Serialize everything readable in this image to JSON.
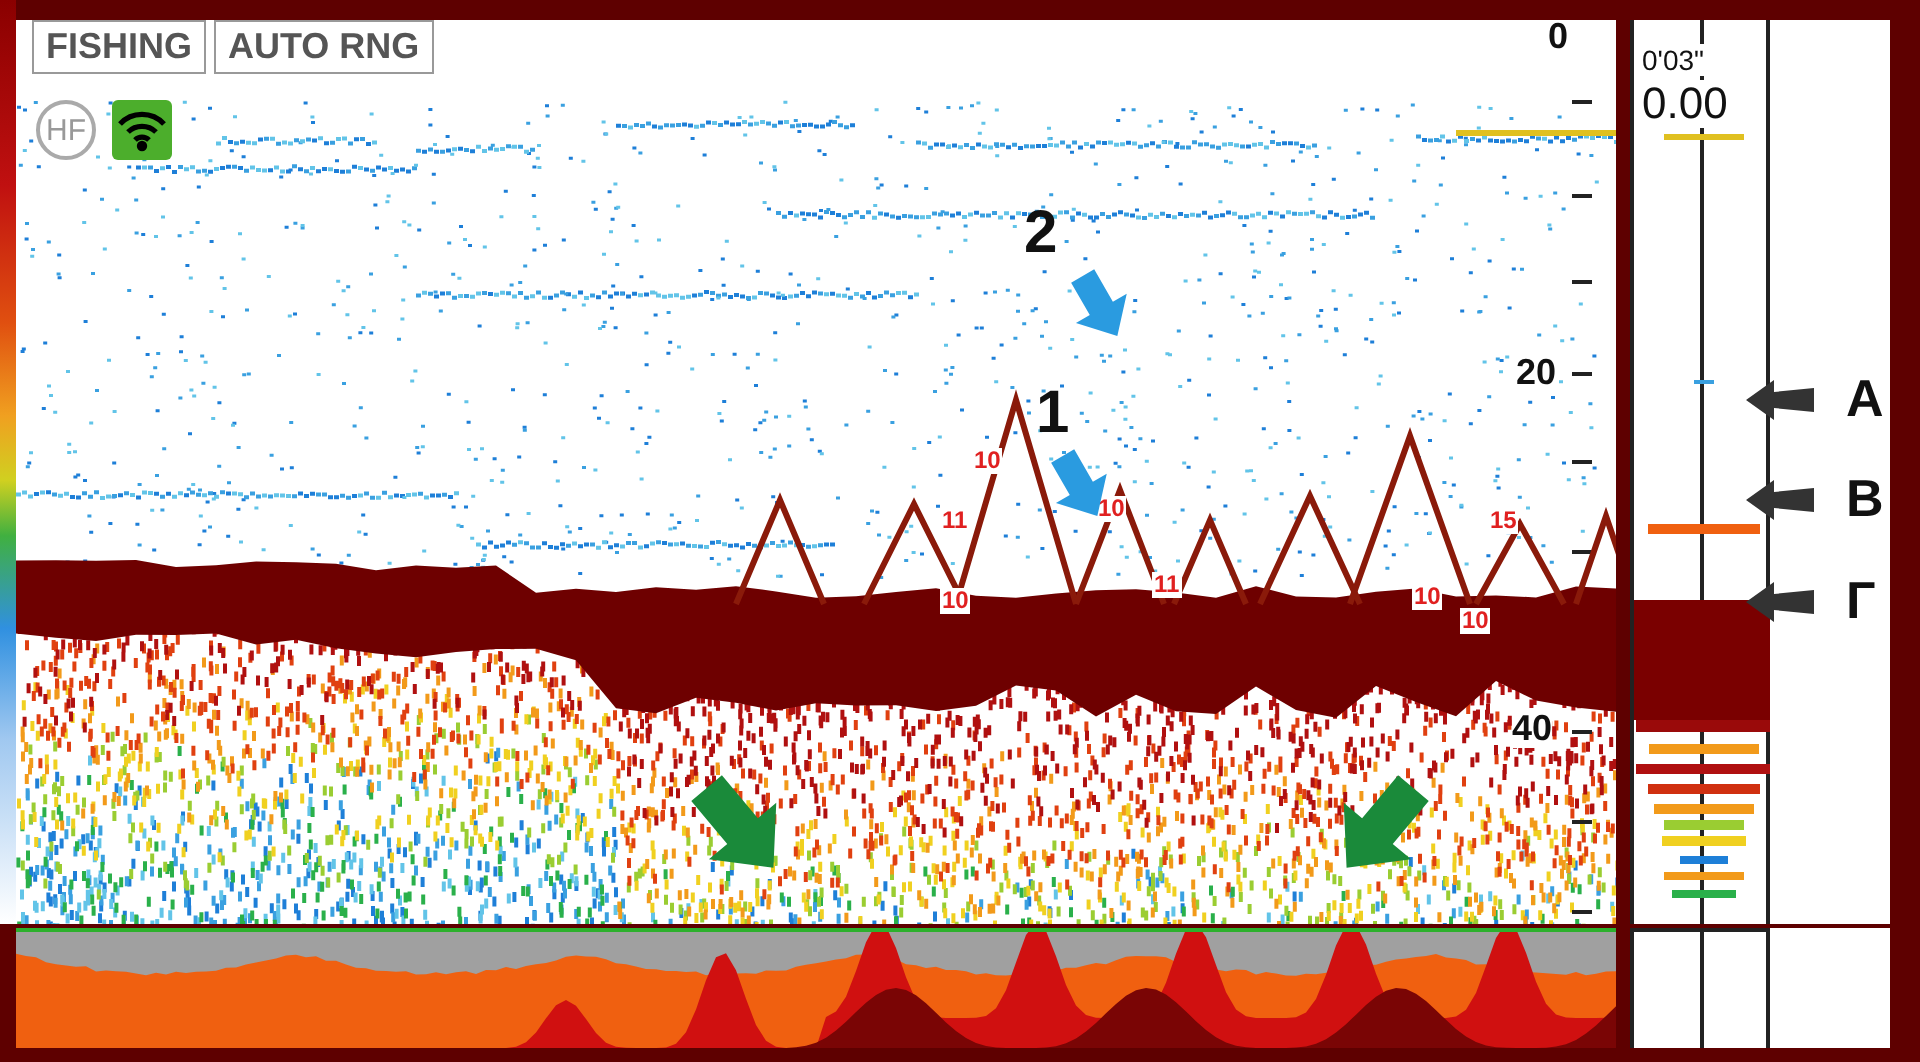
{
  "mode_buttons": [
    {
      "label": "FISHING"
    },
    {
      "label": "AUTO RNG"
    }
  ],
  "frequency_badge": "HF",
  "depth_scale": [
    {
      "label": "0"
    },
    {
      "label": "20"
    },
    {
      "label": "40"
    }
  ],
  "fish_marks": [
    {
      "label": "10"
    },
    {
      "label": "11"
    },
    {
      "label": "10"
    },
    {
      "label": "15"
    },
    {
      "label": "11"
    },
    {
      "label": "10"
    },
    {
      "label": "10"
    },
    {
      "label": "10"
    }
  ],
  "callouts": [
    {
      "label": "2"
    },
    {
      "label": "1"
    }
  ],
  "a_scope": {
    "time": "0'03\"",
    "reading": "0.00"
  },
  "side_labels": [
    {
      "label": "A"
    },
    {
      "label": "B"
    },
    {
      "label": "Г"
    }
  ]
}
